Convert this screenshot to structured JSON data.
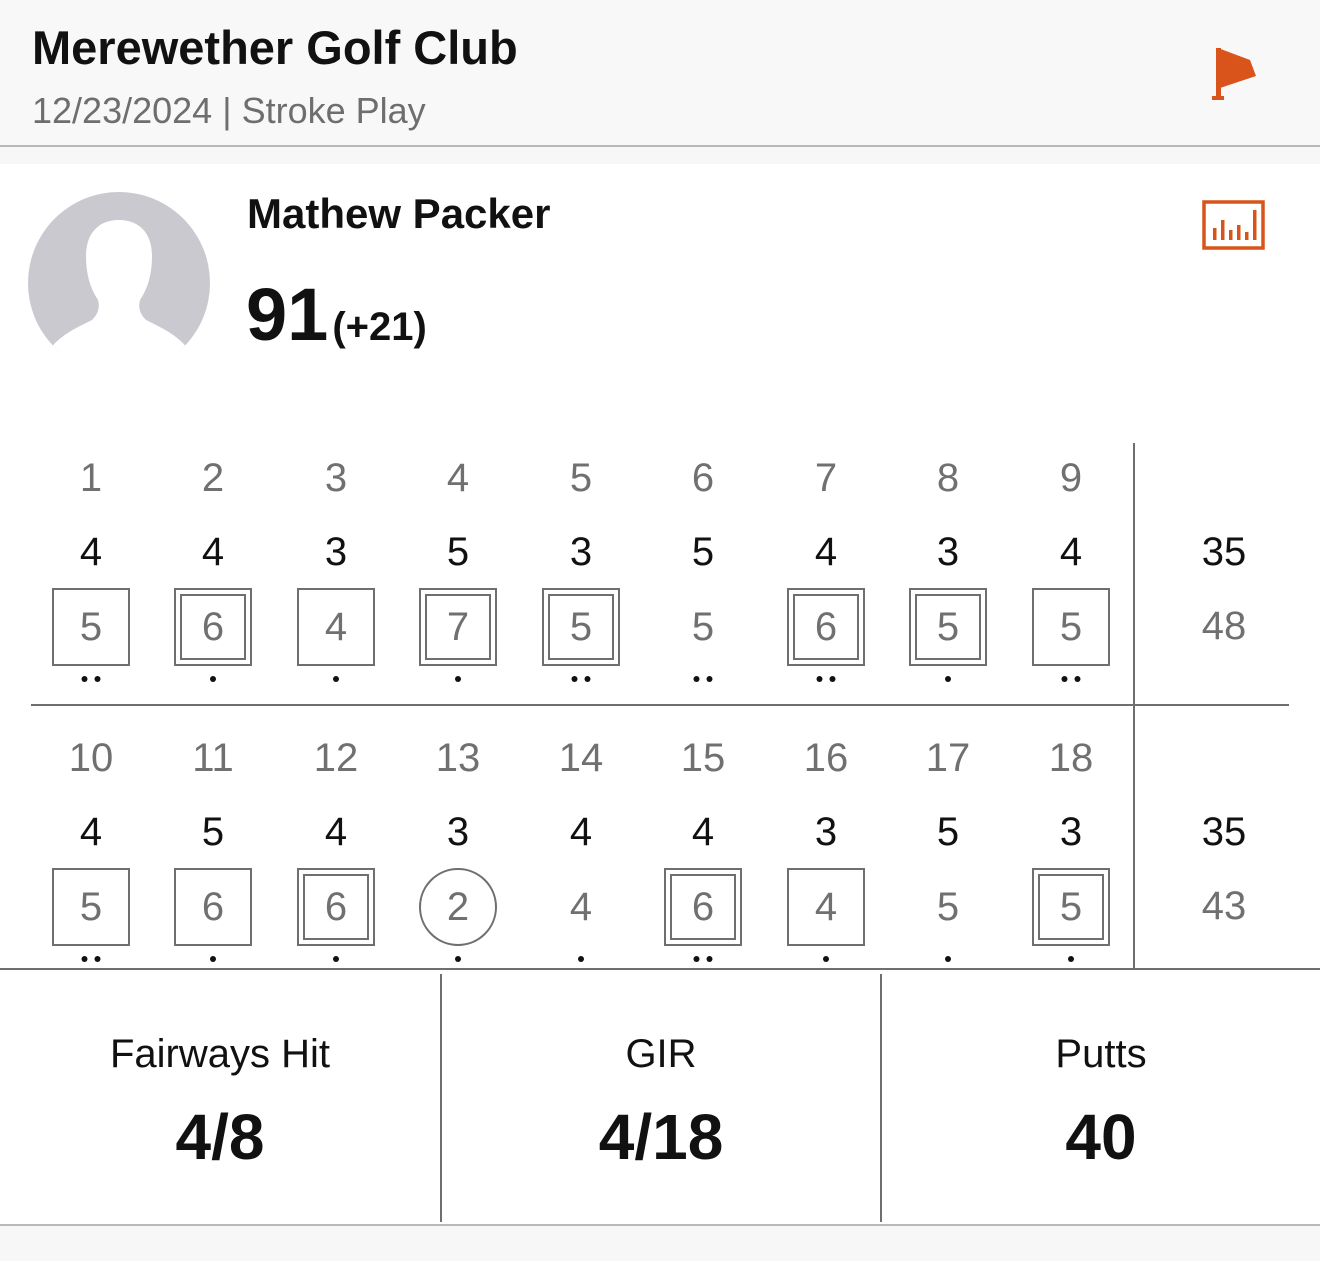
{
  "header": {
    "course_name": "Merewether Golf Club",
    "date": "12/23/2024",
    "separator": "|",
    "format": "Stroke Play",
    "flag_icon": "flag-icon",
    "accent_color": "#d9541a"
  },
  "player": {
    "name": "Mathew Packer",
    "total": "91",
    "to_par": "(+21)",
    "avatar_icon": "person-silhouette-icon",
    "stats_icon": "bar-chart-icon"
  },
  "front_nine": {
    "holes": [
      "1",
      "2",
      "3",
      "4",
      "5",
      "6",
      "7",
      "8",
      "9"
    ],
    "pars": [
      "4",
      "4",
      "3",
      "5",
      "3",
      "5",
      "4",
      "3",
      "4"
    ],
    "scores": [
      "5",
      "6",
      "4",
      "7",
      "5",
      "5",
      "6",
      "5",
      "5"
    ],
    "marks": [
      "sq1",
      "sq2",
      "sq1",
      "sq2",
      "sq2",
      "none",
      "sq2",
      "sq2",
      "sq1"
    ],
    "putts": [
      2,
      1,
      1,
      1,
      2,
      2,
      2,
      1,
      2
    ],
    "par_total": "35",
    "score_total": "48"
  },
  "back_nine": {
    "holes": [
      "10",
      "11",
      "12",
      "13",
      "14",
      "15",
      "16",
      "17",
      "18"
    ],
    "pars": [
      "4",
      "5",
      "4",
      "3",
      "4",
      "4",
      "3",
      "5",
      "3"
    ],
    "scores": [
      "5",
      "6",
      "6",
      "2",
      "4",
      "6",
      "4",
      "5",
      "5"
    ],
    "marks": [
      "sq1",
      "sq1",
      "sq2",
      "circ",
      "none",
      "sq2",
      "sq1",
      "none",
      "sq2"
    ],
    "putts": [
      2,
      1,
      1,
      1,
      1,
      2,
      1,
      1,
      1
    ],
    "par_total": "35",
    "score_total": "43"
  },
  "stats": {
    "fairways_label": "Fairways Hit",
    "fairways_value": "4/8",
    "gir_label": "GIR",
    "gir_value": "4/18",
    "putts_label": "Putts",
    "putts_value": "40"
  }
}
